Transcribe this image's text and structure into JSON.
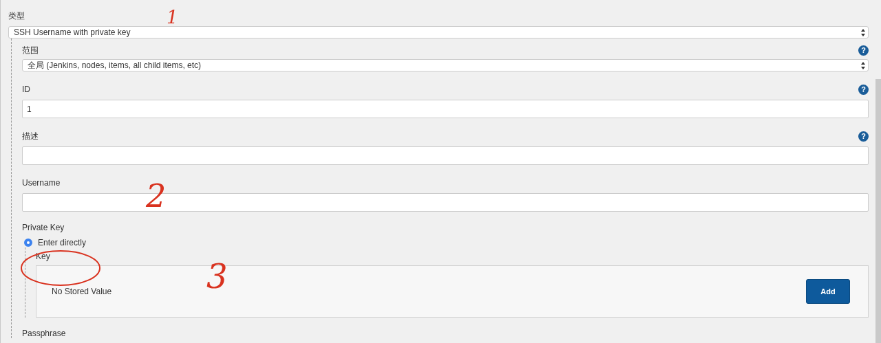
{
  "credential_type": {
    "label": "类型",
    "value": "SSH Username with private key"
  },
  "fields": [
    {
      "kind": "select",
      "label": "范围",
      "value": "全局 (Jenkins, nodes, items, all child items, etc)",
      "help": "?"
    },
    {
      "kind": "input",
      "label": "ID",
      "value": "1",
      "help": "?"
    },
    {
      "kind": "input",
      "label": "描述",
      "help": "?"
    },
    {
      "kind": "input",
      "label": "Username"
    }
  ],
  "private_key": {
    "label": "Private Key",
    "options": [
      {
        "label": "Enter directly",
        "selected": true
      }
    ],
    "key_label": "Key",
    "key_status": "No Stored Value",
    "add_button": "Add"
  },
  "passphrase": {
    "label": "Passphrase"
  },
  "annotations": [
    {
      "kind": "number",
      "text": "1"
    },
    {
      "kind": "number",
      "text": "2"
    },
    {
      "kind": "circle"
    },
    {
      "kind": "number",
      "text": "3"
    }
  ]
}
